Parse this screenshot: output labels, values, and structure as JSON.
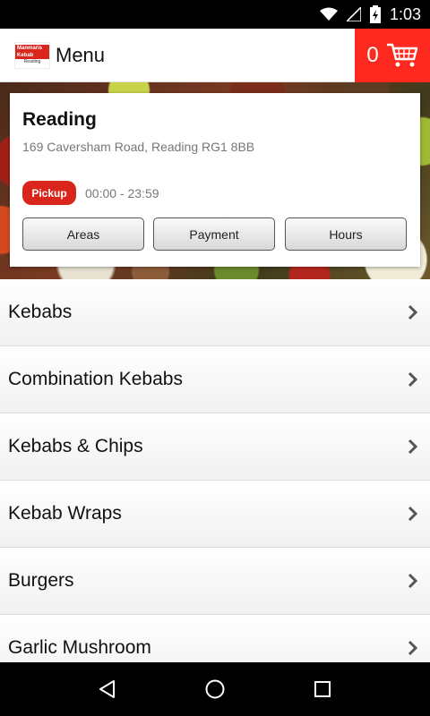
{
  "status_bar": {
    "time": "1:03"
  },
  "app_bar": {
    "logo_line1": "Manmaris Kebab",
    "logo_line2": "Reading",
    "title": "Menu",
    "cart_count": "0"
  },
  "store": {
    "name": "Reading",
    "address": "169 Caversham Road, Reading RG1 8BB",
    "mode": "Pickup",
    "hours": "00:00 - 23:59",
    "buttons": {
      "areas": "Areas",
      "payment": "Payment",
      "hours": "Hours"
    }
  },
  "menu": {
    "items": [
      {
        "label": "Kebabs"
      },
      {
        "label": "Combination Kebabs"
      },
      {
        "label": "Kebabs & Chips"
      },
      {
        "label": "Kebab Wraps"
      },
      {
        "label": "Burgers"
      },
      {
        "label": "Garlic Mushroom"
      }
    ]
  },
  "colors": {
    "accent": "#ff2a1f",
    "badge": "#d9251c"
  },
  "icons": [
    "wifi-icon",
    "signal-icon",
    "battery-icon",
    "cart-icon",
    "chevron-right-icon",
    "back-icon",
    "home-icon",
    "recents-icon"
  ]
}
